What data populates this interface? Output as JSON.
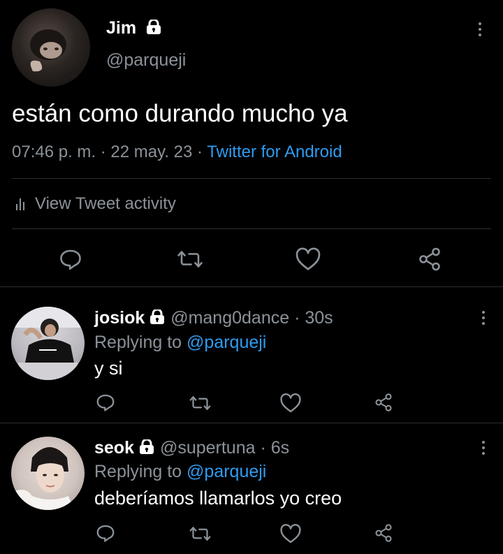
{
  "main_tweet": {
    "display_name": "Jim",
    "handle": "@parqueji",
    "text": "están como durando mucho ya",
    "time": "07:46 p. m.",
    "sep1": "·",
    "date": "22 may. 23",
    "sep2": "·",
    "source": "Twitter for Android",
    "activity_label": "View Tweet activity"
  },
  "replies": [
    {
      "display_name": "josiok",
      "handle": "@mang0dance",
      "sep": "·",
      "age": "30s",
      "replying_prefix": "Replying to",
      "replying_to": "@parqueji",
      "text": "y si"
    },
    {
      "display_name": "seok",
      "handle": "@supertuna",
      "sep": "·",
      "age": "6s",
      "replying_prefix": "Replying to",
      "replying_to": "@parqueji",
      "text": "deberíamos llamarlos yo creo"
    }
  ],
  "colors": {
    "background": "#000000",
    "link": "#2f9bf0",
    "secondary_text": "#8b9299",
    "divider": "#2a2e33"
  },
  "icons": [
    "lock-icon",
    "more-icon",
    "activity-icon",
    "reply-icon",
    "retweet-icon",
    "like-icon",
    "share-icon"
  ]
}
